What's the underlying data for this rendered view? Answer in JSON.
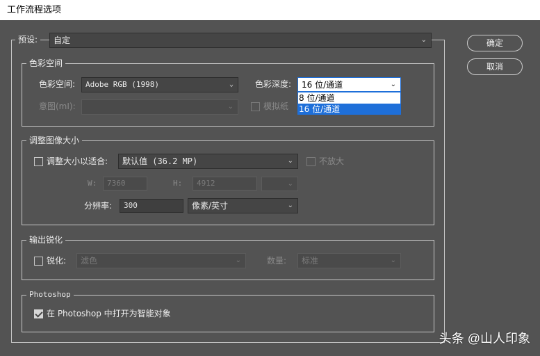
{
  "window": {
    "title": "工作流程选项"
  },
  "preset": {
    "label": "预设:",
    "value": "自定"
  },
  "buttons": {
    "ok": "确定",
    "cancel": "取消"
  },
  "color_space_group": {
    "legend": "色彩空间",
    "space_label": "色彩空间:",
    "space_value": "Adobe RGB (1998)",
    "depth_label": "色彩深度:",
    "depth_value": "16 位/通道",
    "depth_options": [
      "8 位/通道",
      "16 位/通道"
    ],
    "depth_selected_index": 1,
    "intent_label": "意图(mI):",
    "intent_value": "",
    "simulate_label": "模拟纸"
  },
  "resize_group": {
    "legend": "调整图像大小",
    "fit_label": "调整大小以适合:",
    "fit_value": "默认值 (36.2 MP)",
    "fit_checked": false,
    "no_enlarge_label": "不放大",
    "w_label": "W:",
    "w_value": "7360",
    "h_label": "H:",
    "h_value": "4912",
    "unit_value": "",
    "resolution_label": "分辨率:",
    "resolution_value": "300",
    "resolution_unit": "像素/英寸"
  },
  "sharpen_group": {
    "legend": "输出锐化",
    "sharpen_label": "锐化:",
    "sharpen_checked": false,
    "sharpen_value": "滤色",
    "amount_label": "数量:",
    "amount_value": "标准"
  },
  "photoshop_group": {
    "legend": "Photoshop",
    "smart_object_label": "在 Photoshop 中打开为智能对象",
    "smart_object_checked": true
  },
  "watermark": "头条 @山人印象"
}
